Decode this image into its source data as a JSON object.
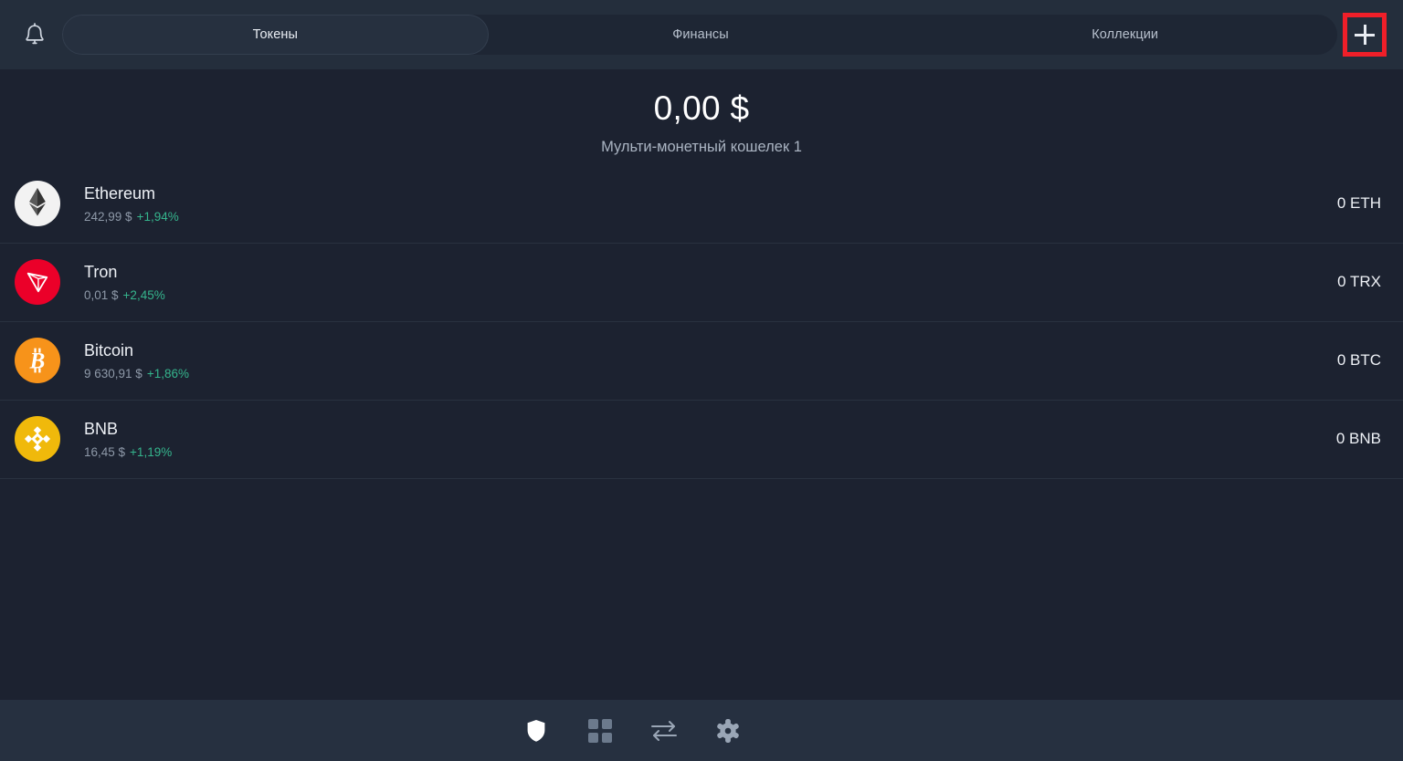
{
  "header": {
    "bell_icon": "bell-icon",
    "add_button_label": "+",
    "tabs": [
      {
        "label": "Токены",
        "active": true
      },
      {
        "label": "Финансы",
        "active": false
      },
      {
        "label": "Коллекции",
        "active": false
      }
    ]
  },
  "balance": {
    "amount": "0,00 $",
    "wallet_name": "Мульти-монетный кошелек 1"
  },
  "assets": [
    {
      "name": "Ethereum",
      "price": "242,99 $",
      "change": "+1,94%",
      "balance": "0 ETH",
      "icon": "ethereum-icon",
      "icon_bg": "#f2f2f2"
    },
    {
      "name": "Tron",
      "price": "0,01 $",
      "change": "+2,45%",
      "balance": "0 TRX",
      "icon": "tron-icon",
      "icon_bg": "#eb0029"
    },
    {
      "name": "Bitcoin",
      "price": "9 630,91 $",
      "change": "+1,86%",
      "balance": "0 BTC",
      "icon": "bitcoin-icon",
      "icon_bg": "#f7931a"
    },
    {
      "name": "BNB",
      "price": "16,45 $",
      "change": "+1,19%",
      "balance": "0 BNB",
      "icon": "bnb-icon",
      "icon_bg": "#f0b90b"
    }
  ],
  "bottom_nav": [
    {
      "icon": "shield-icon",
      "active": true
    },
    {
      "icon": "grid-icon",
      "active": false
    },
    {
      "icon": "swap-icon",
      "active": false
    },
    {
      "icon": "gear-icon",
      "active": false
    }
  ],
  "colors": {
    "background": "#1c2230",
    "header_bg": "#242e3c",
    "nav_bg": "#263040",
    "accent_positive": "#35b58d",
    "highlight_box": "#f01f29"
  }
}
